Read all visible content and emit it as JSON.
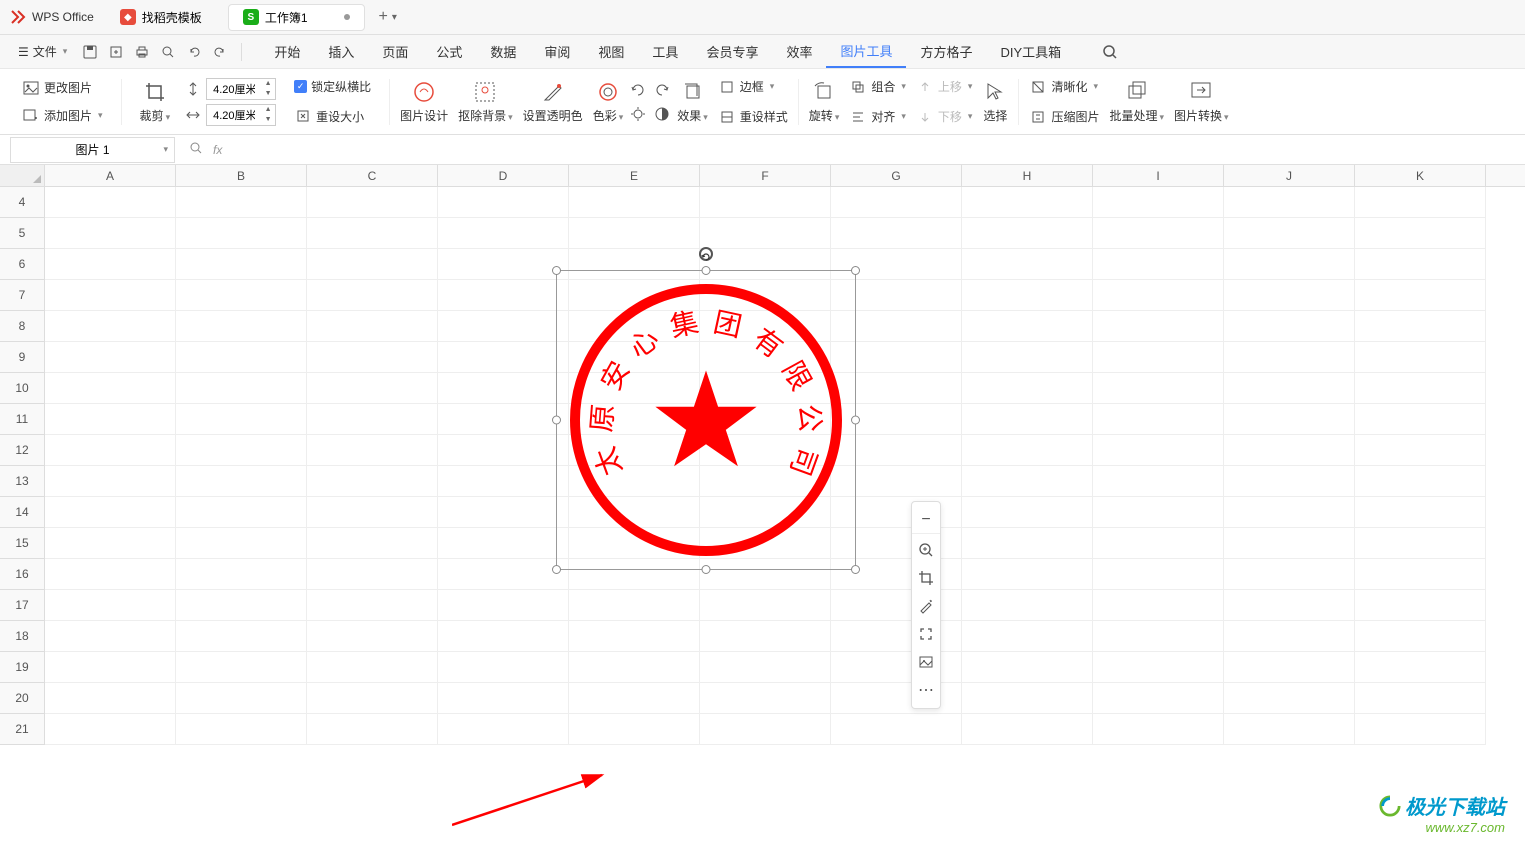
{
  "titlebar": {
    "app_name": "WPS Office",
    "tab1_label": "找稻壳模板",
    "tab2_label": "工作簿1",
    "add_label": "+"
  },
  "menubar": {
    "file_label": "文件",
    "tabs": [
      "开始",
      "插入",
      "页面",
      "公式",
      "数据",
      "审阅",
      "视图",
      "工具",
      "会员专享",
      "效率",
      "图片工具",
      "方方格子",
      "DIY工具箱"
    ],
    "active_index": 10
  },
  "ribbon": {
    "change_pic": "更改图片",
    "add_pic": "添加图片",
    "crop": "裁剪",
    "height": "4.20厘米",
    "width": "4.20厘米",
    "lock_ratio": "锁定纵横比",
    "reset_size": "重设大小",
    "pic_design": "图片设计",
    "remove_bg": "抠除背景",
    "set_transparency": "设置透明色",
    "color": "色彩",
    "effect": "效果",
    "border": "边框",
    "reset_style": "重设样式",
    "rotate": "旋转",
    "combine": "组合",
    "align": "对齐",
    "move_up": "上移",
    "move_down": "下移",
    "select": "选择",
    "clarity": "清晰化",
    "compress": "压缩图片",
    "batch": "批量处理",
    "convert": "图片转换"
  },
  "namebox": {
    "value": "图片 1",
    "fx": "fx"
  },
  "columns": [
    "A",
    "B",
    "C",
    "D",
    "E",
    "F",
    "G",
    "H",
    "I",
    "J",
    "K"
  ],
  "rows": [
    4,
    5,
    6,
    7,
    8,
    9,
    10,
    11,
    12,
    13,
    14,
    15,
    16,
    17,
    18,
    19,
    20,
    21
  ],
  "stamp": {
    "chars": [
      "太",
      "原",
      "安",
      "心",
      "集",
      "团",
      "有",
      "限",
      "公",
      "司"
    ]
  },
  "watermark": {
    "line1": "极光下载站",
    "line2": "www.xz7.com"
  }
}
